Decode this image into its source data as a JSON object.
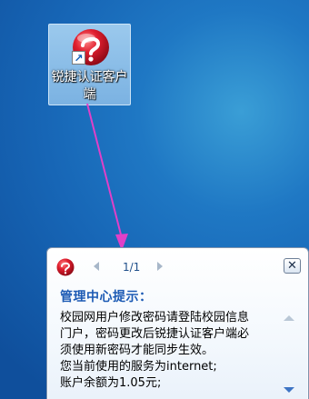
{
  "desktop_icon": {
    "label": "锐捷认证客户端",
    "icon": "ruijie-logo-icon",
    "shortcut_overlay": "shortcut-arrow-icon"
  },
  "annotation": {
    "color": "#e040c8"
  },
  "balloon": {
    "icon": "ruijie-logo-icon",
    "page_indicator": "1/1",
    "title": "管理中心提示：",
    "body_lines": [
      "校园网用户修改密码请登陆校园信息",
      "门户，密码更改后锐捷认证客户端必",
      "须使用新密码才能同步生效。",
      "您当前使用的服务为internet;",
      "账户余额为1.05元;"
    ]
  },
  "colors": {
    "desktop": "#1f78c4",
    "title": "#1c5ab4",
    "logo_red": "#d0182a"
  }
}
